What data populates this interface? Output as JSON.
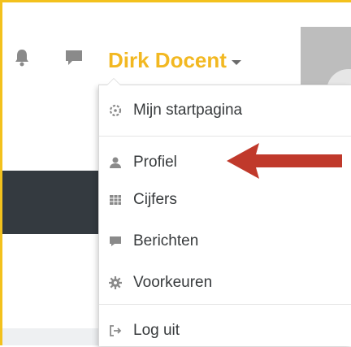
{
  "header": {
    "user_name": "Dirk Docent",
    "notifications_icon": "bell-icon",
    "messages_icon": "chat-icon"
  },
  "menu": {
    "items": [
      {
        "label": "Mijn startpagina",
        "icon": "dashboard-icon"
      },
      {
        "label": "Profiel",
        "icon": "user-icon"
      },
      {
        "label": "Cijfers",
        "icon": "grades-table-icon"
      },
      {
        "label": "Berichten",
        "icon": "chat-icon"
      },
      {
        "label": "Voorkeuren",
        "icon": "gear-icon"
      },
      {
        "label": "Log uit",
        "icon": "logout-icon"
      }
    ]
  },
  "annotation": {
    "color": "#c0392b",
    "points_to": "Profiel"
  },
  "colors": {
    "accent": "#f2b821",
    "frame_border": "#f3c11d",
    "dark_bar": "#343a40"
  }
}
